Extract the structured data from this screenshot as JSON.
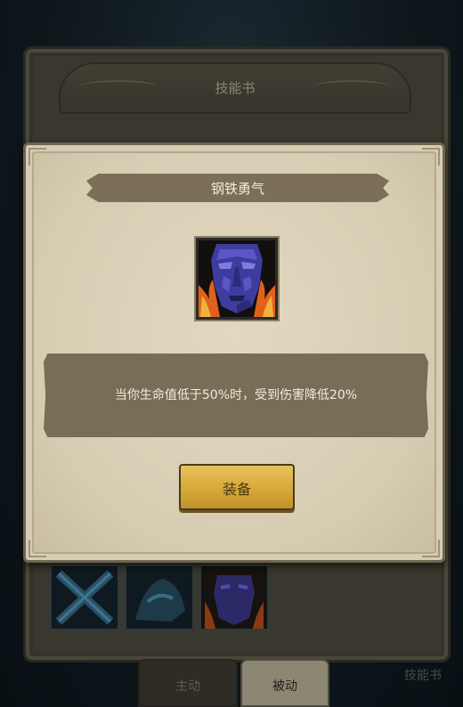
{
  "background_book": {
    "header_title": "技能书",
    "tabs": [
      "主动",
      "被动"
    ],
    "corner_label": "技能书",
    "skill_slots": [
      "crossed-swords-icon",
      "shadow-beast-icon",
      "iron-face-icon"
    ]
  },
  "popup": {
    "skill_name": "钢铁勇气",
    "skill_icon": "iron-face-icon",
    "description": "当你生命值低于50%时，受到伤害降低20%",
    "equip_label": "装备"
  },
  "colors": {
    "parchment": "#d7cdb4",
    "banner": "#7b7057",
    "button_gold": "#d6a93a",
    "face_purple": "#4a47b8",
    "flame_orange": "#e0611c"
  }
}
